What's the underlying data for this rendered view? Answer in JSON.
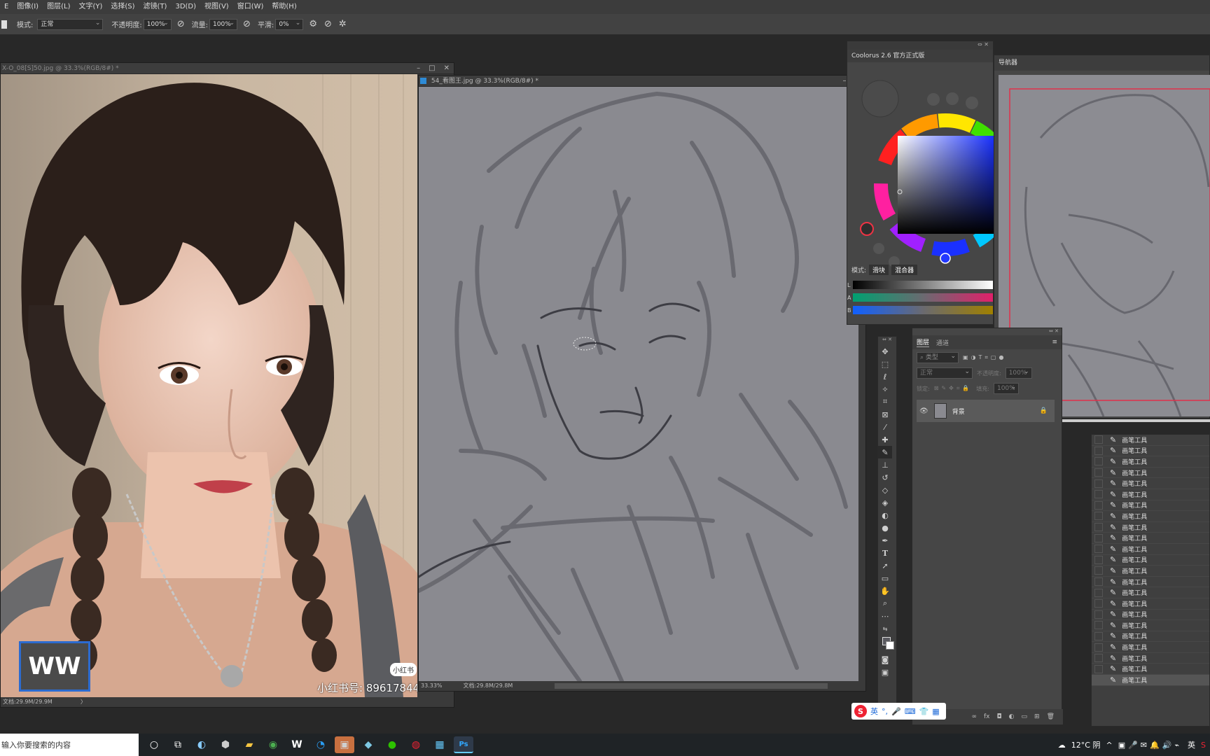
{
  "menu": [
    "图像(I)",
    "图层(L)",
    "文字(Y)",
    "选择(S)",
    "滤镜(T)",
    "3D(D)",
    "视图(V)",
    "窗口(W)",
    "帮助(H)"
  ],
  "options": {
    "mode_label": "模式:",
    "mode_value": "正常",
    "opacity_label": "不透明度:",
    "opacity_value": "100%",
    "flow_label": "流量:",
    "flow_value": "100%",
    "smooth_label": "平滑:",
    "smooth_value": "0%"
  },
  "doc1": {
    "title": "X-O_08[S]50.jpg @ 33.3%(RGB/8#) *",
    "status": "文档:29.9M/29.9M",
    "watermark_logo": "WW",
    "watermark_badge": "小红书",
    "watermark_text": "小红书号: 89617844"
  },
  "doc2": {
    "title": "54_看图王.jpg @ 33.3%(RGB/8#) *",
    "zoom": "33.33%",
    "status": "文档:29.8M/29.8M"
  },
  "coolorus": {
    "title": "Coolorus 2.6 官方正式版",
    "mode_label": "模式:",
    "tab1": "滑块",
    "tab2": "混合器",
    "slider_labels": [
      "L",
      "A",
      "B"
    ]
  },
  "navigator": {
    "title": "导航器"
  },
  "layers": {
    "tab1": "图层",
    "tab2": "通道",
    "search_placeholder": "类型",
    "blend": "正常",
    "opacity_label": "不透明度:",
    "opacity_value": "100%",
    "lock_label": "锁定:",
    "fill_label": "填充:",
    "fill_value": "100%",
    "layer_name": "背景"
  },
  "history": {
    "item_label": "画笔工具",
    "count": 23
  },
  "ime": {
    "lang": "英"
  },
  "taskbar": {
    "search_placeholder": "输入你要搜索的内容",
    "weather": "12°C 阴",
    "lang": "英"
  }
}
